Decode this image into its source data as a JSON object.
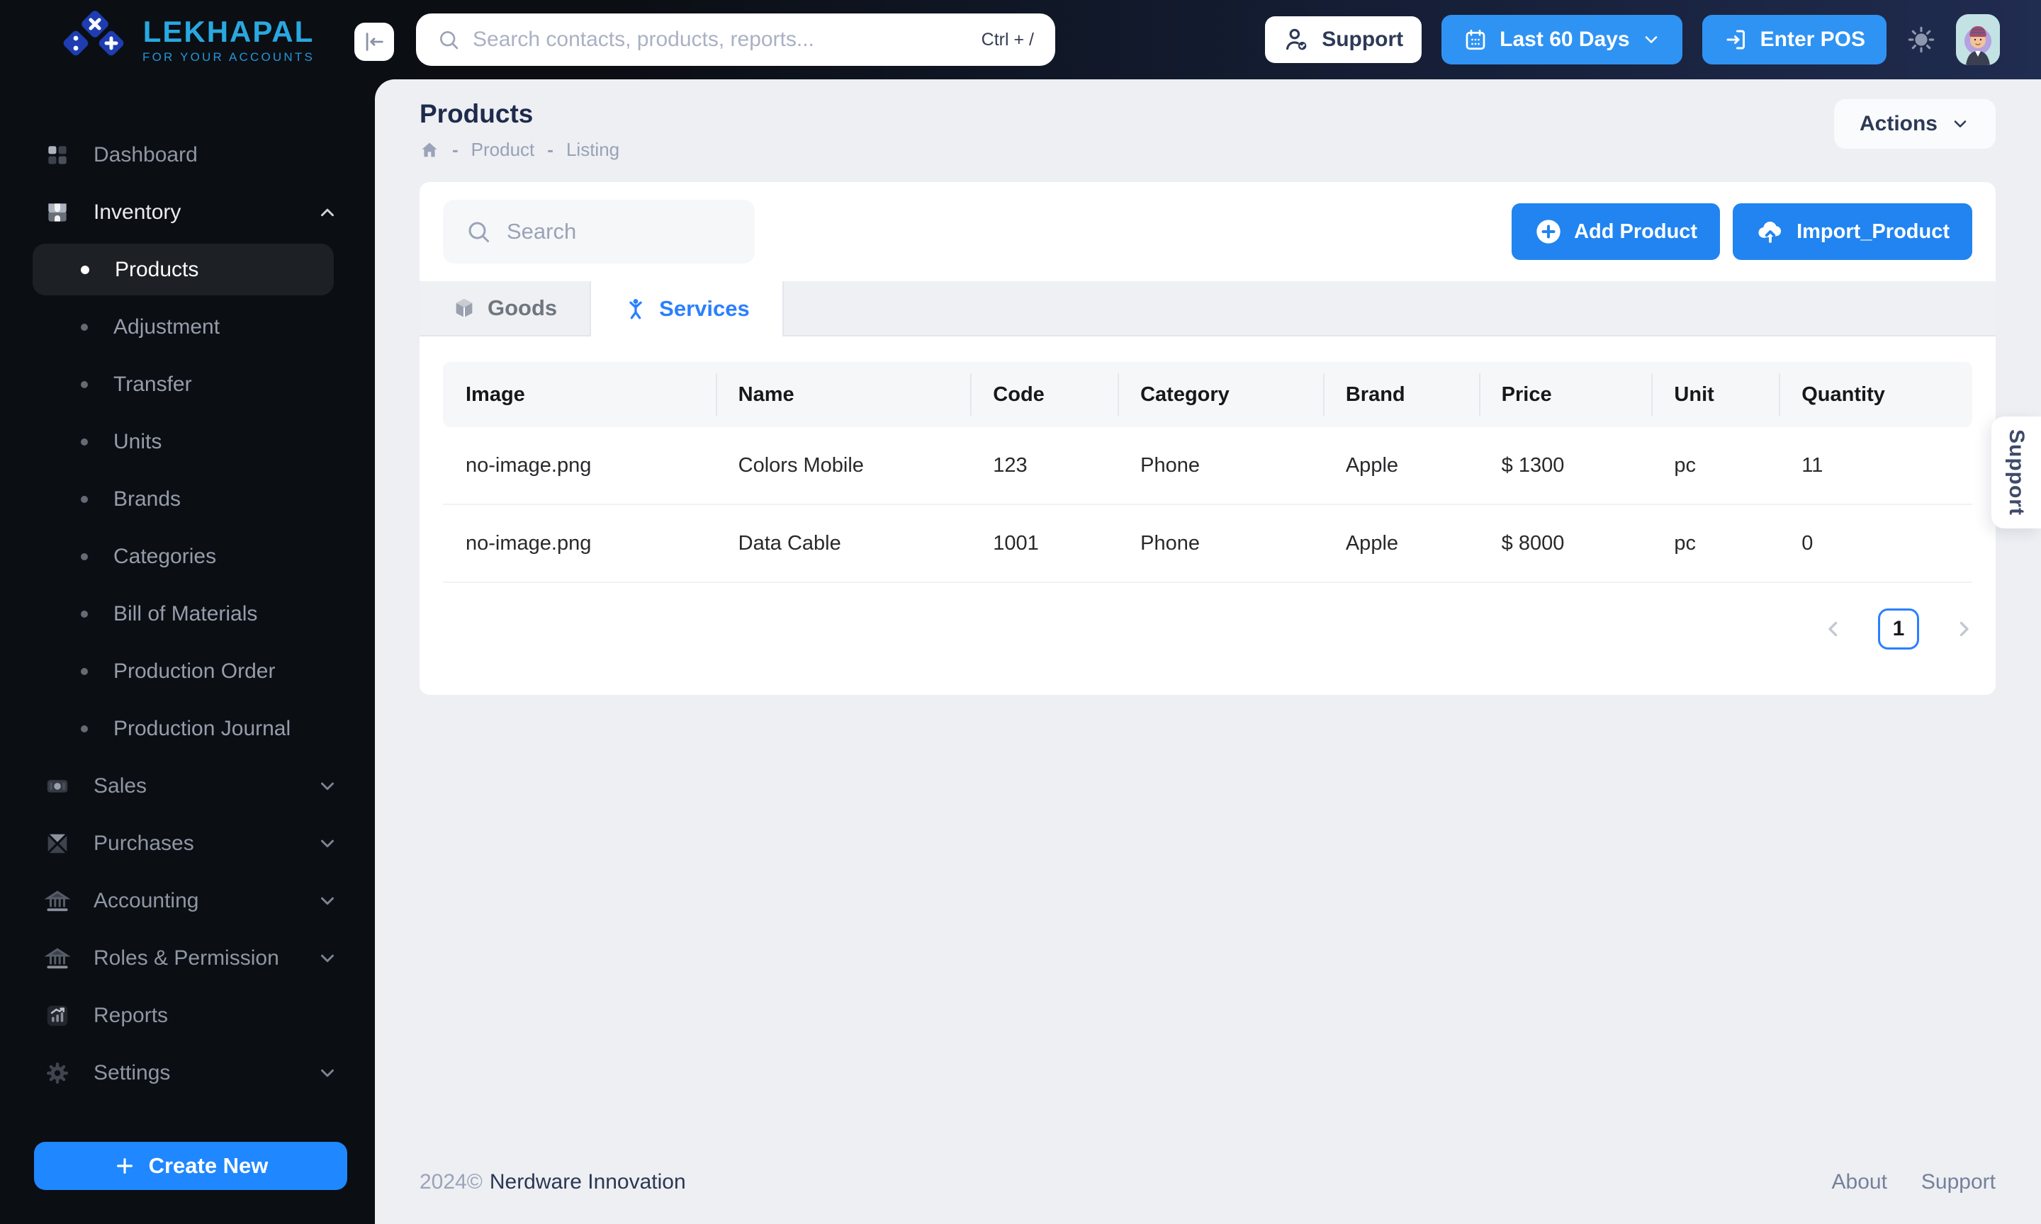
{
  "brand": {
    "name": "LEKHAPAL",
    "tagline": "FOR YOUR ACCOUNTS"
  },
  "header": {
    "search_placeholder": "Search contacts, products, reports...",
    "search_shortcut": "Ctrl + /",
    "support_label": "Support",
    "date_range_label": "Last 60 Days",
    "enter_pos_label": "Enter POS"
  },
  "sidebar": {
    "dashboard": "Dashboard",
    "inventory": "Inventory",
    "inventory_children": [
      "Products",
      "Adjustment",
      "Transfer",
      "Units",
      "Brands",
      "Categories",
      "Bill of Materials",
      "Production Order",
      "Production Journal"
    ],
    "active_child": "Products",
    "sales": "Sales",
    "purchases": "Purchases",
    "accounting": "Accounting",
    "roles": "Roles & Permission",
    "reports": "Reports",
    "settings": "Settings",
    "create_new": "Create New"
  },
  "page": {
    "title": "Products",
    "breadcrumb_sep": "-",
    "breadcrumb": [
      "Product",
      "Listing"
    ],
    "actions_label": "Actions"
  },
  "toolbar": {
    "search_placeholder": "Search",
    "add_product": "Add Product",
    "import_product": "Import_Product"
  },
  "tabs": [
    {
      "label": "Goods",
      "active": false
    },
    {
      "label": "Services",
      "active": true
    }
  ],
  "table": {
    "columns": [
      "Image",
      "Name",
      "Code",
      "Category",
      "Brand",
      "Price",
      "Unit",
      "Quantity"
    ],
    "rows": [
      {
        "image": "no-image.png",
        "name": "Colors Mobile",
        "code": "123",
        "category": "Phone",
        "brand": "Apple",
        "price": "$ 1300",
        "unit": "pc",
        "quantity": "11"
      },
      {
        "image": "no-image.png",
        "name": "Data Cable",
        "code": "1001",
        "category": "Phone",
        "brand": "Apple",
        "price": "$ 8000",
        "unit": "pc",
        "quantity": "0"
      }
    ]
  },
  "pagination": {
    "current_page": "1"
  },
  "footer": {
    "year": "2024©",
    "company": "Nerdware Innovation",
    "links": [
      "About",
      "Support"
    ]
  },
  "side_tab": {
    "label": "Support"
  },
  "colors": {
    "accent_blue": "#2184f0",
    "header_button_blue": "#2f93f3",
    "create_new_blue": "#1f87ff",
    "brand_light_blue": "#29a8e0",
    "logo_diamond_blue": "#1d3db0",
    "active_tab_blue": "#2b7fff",
    "sidebar_bg": "#0b0e13",
    "main_bg": "#edeff3"
  }
}
